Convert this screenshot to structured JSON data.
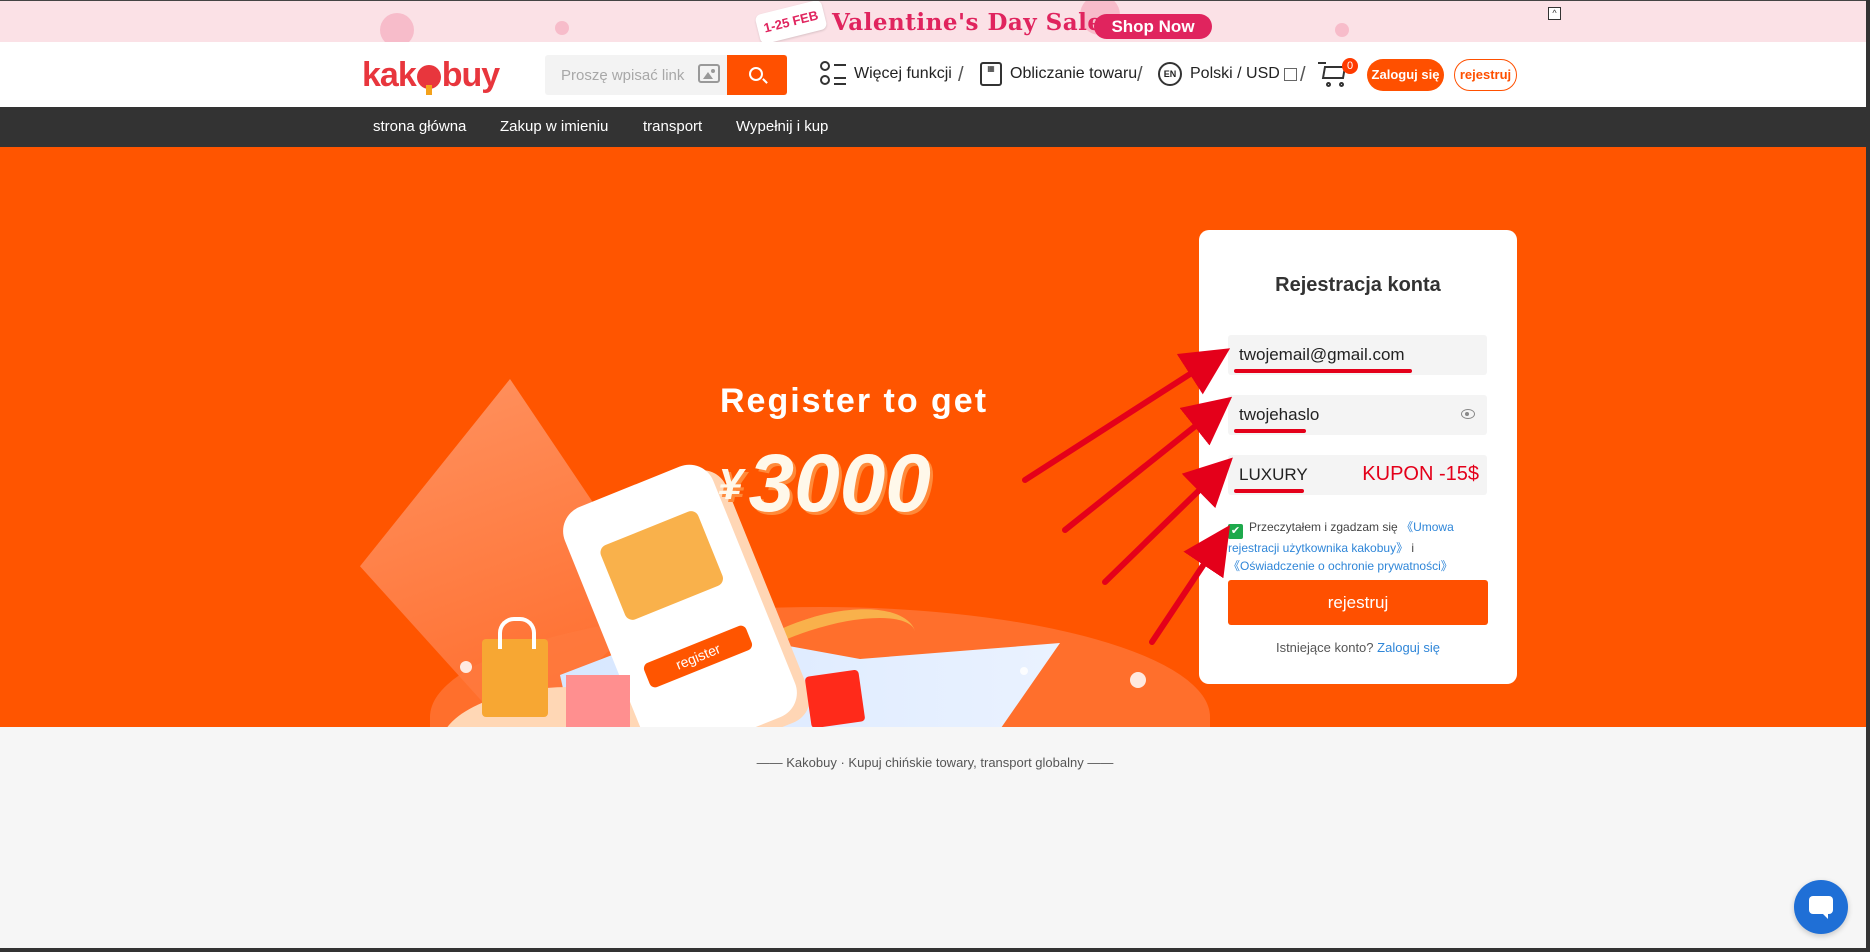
{
  "promo": {
    "date_badge": "1-25 FEB",
    "title": "Valentine's Day Sale",
    "cta": "Shop Now",
    "close_glyph": "^"
  },
  "header": {
    "logo_part1": "k",
    "logo_part2": "ak",
    "logo_part3": "buy",
    "search_placeholder": "Proszę wpisać link",
    "more_features": "Więcej funkcji",
    "calc_goods": "Obliczanie towaru",
    "lang_badge": "EN",
    "lang_currency": "Polski / USD",
    "cart_count": "0",
    "login": "Zaloguj się",
    "register": "rejestruj",
    "separator": "/"
  },
  "nav": {
    "items": [
      {
        "label": "strona główna"
      },
      {
        "label": "Zakup w imieniu"
      },
      {
        "label": "transport"
      },
      {
        "label": "Wypełnij i kup"
      }
    ]
  },
  "hero": {
    "headline": "Register to get",
    "currency": "¥",
    "amount": "3000",
    "phone_button": "register"
  },
  "form": {
    "title": "Rejestracja konta",
    "email_value": "twojemail@gmail.com",
    "password_value": "twojehaslo",
    "coupon_value": "LUXURY",
    "coupon_note": "KUPON -15$",
    "agree_text": "Przeczytałem i zgadzam się",
    "agree_link1": "《Umowa rejestracji użytkownika kakobuy》",
    "agree_and": "i",
    "agree_link2": "《Oświadczenie o ochronie prywatności》",
    "submit": "rejestruj",
    "existing_text": "Istniejące konto?",
    "existing_link": "Zaloguj się"
  },
  "footer": {
    "tagline": "—— Kakobuy · Kupuj chińskie towary, transport globalny ——"
  },
  "colors": {
    "accent": "#ff5000",
    "hero_bg": "#ff5500",
    "annotation_red": "#e4001a",
    "link_blue": "#2f86d8",
    "nav_bg": "#333333"
  }
}
